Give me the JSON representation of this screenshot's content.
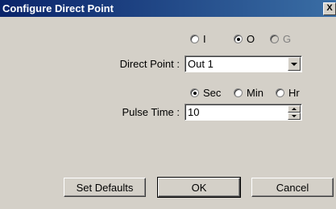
{
  "window": {
    "title": "Configure Direct Point",
    "close_label": "X"
  },
  "point_type": {
    "options": [
      {
        "label": "I",
        "selected": false,
        "enabled": true
      },
      {
        "label": "O",
        "selected": true,
        "enabled": true
      },
      {
        "label": "G",
        "selected": false,
        "enabled": false
      }
    ]
  },
  "direct_point": {
    "label": "Direct Point :",
    "value": "Out 1"
  },
  "time_unit": {
    "options": [
      {
        "label": "Sec",
        "selected": true
      },
      {
        "label": "Min",
        "selected": false
      },
      {
        "label": "Hr",
        "selected": false
      }
    ]
  },
  "pulse_time": {
    "label": "Pulse Time :",
    "value": "10"
  },
  "buttons": {
    "set_defaults": "Set Defaults",
    "ok": "OK",
    "cancel": "Cancel"
  }
}
